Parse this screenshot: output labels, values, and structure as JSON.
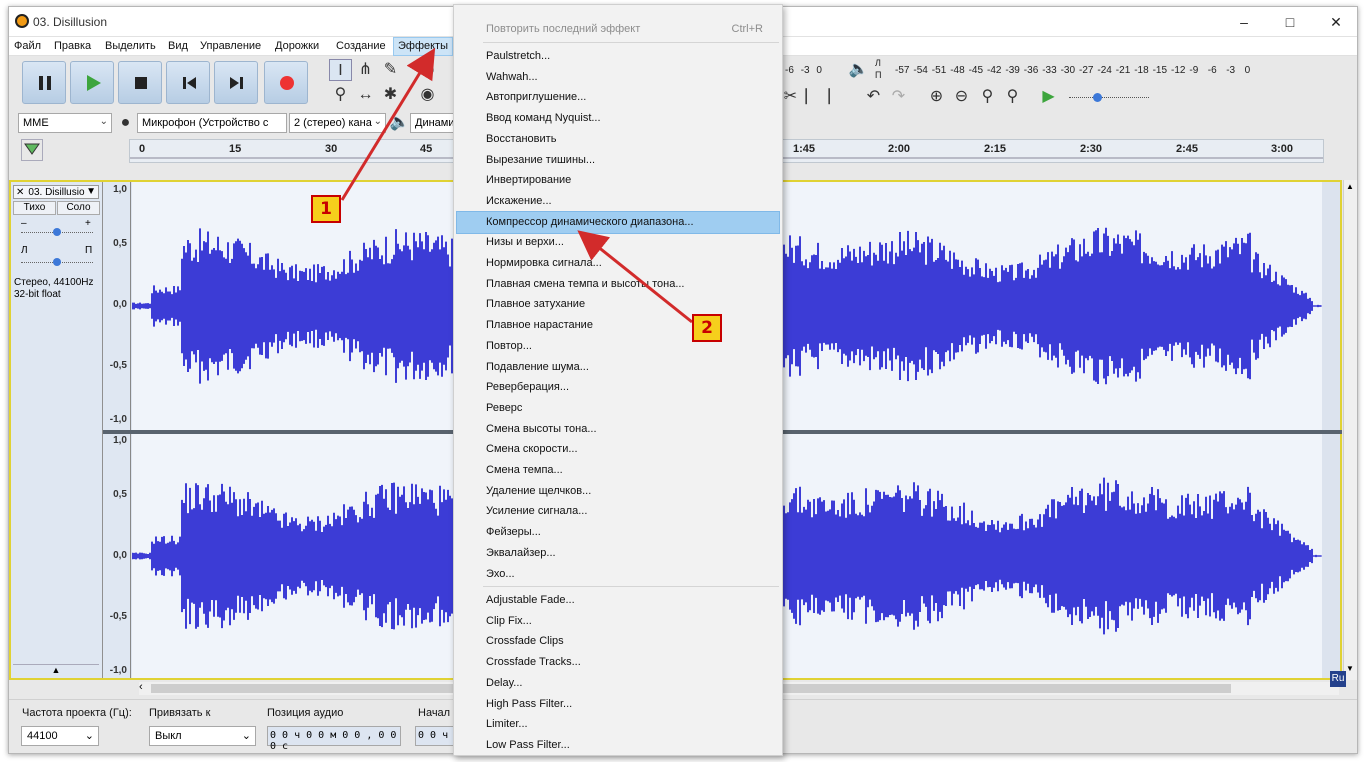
{
  "window": {
    "title": "03. Disillusion"
  },
  "menubar": {
    "items": [
      "Файл",
      "Правка",
      "Выделить",
      "Вид",
      "Управление",
      "Дорожки",
      "Создание",
      "Эффекты"
    ]
  },
  "toolbar": {
    "host": "MME",
    "microphone": "Микрофон (Устройство с",
    "channels": "2 (стерео) кана",
    "speaker": "Динами",
    "meter_left_ticks": [
      "-6",
      "-3",
      "0"
    ],
    "meter_right_ticks": [
      "-57",
      "-54",
      "-51",
      "-48",
      "-45",
      "-42",
      "-39",
      "-36",
      "-33",
      "-30",
      "-27",
      "-24",
      "-21",
      "-18",
      "-15",
      "-12",
      "-9",
      "-6",
      "-3",
      "0"
    ],
    "meter_labels": [
      "Л",
      "П"
    ]
  },
  "timeline": {
    "ticks": [
      "0",
      "15",
      "30",
      "45",
      "1:45",
      "2:00",
      "2:15",
      "2:30",
      "2:45",
      "3:00"
    ]
  },
  "track": {
    "name": "03. Disillusio",
    "mute": "Тихо",
    "solo": "Соло",
    "gain_minus": "–",
    "gain_plus": "+",
    "pan_left": "Л",
    "pan_right": "П",
    "info_line1": "Стерео, 44100Hz",
    "info_line2": "32-bit float",
    "ruler_labels": [
      "1,0",
      "0,5",
      "0,0",
      "-0,5",
      "-1,0"
    ]
  },
  "bottom": {
    "rate_label": "Частота проекта (Гц):",
    "rate_value": "44100",
    "snap_label": "Привязать к",
    "snap_value": "Выкл",
    "pos_label": "Позиция аудио",
    "pos_value": "0 0 ч 0 0 м 0 0 , 0 0 0 с",
    "start_label": "Начал",
    "start_value": "0 0 ч"
  },
  "effects_menu": {
    "repeat_label": "Повторить последний эффект",
    "repeat_shortcut": "Ctrl+R",
    "items": [
      "Paulstretch...",
      "Wahwah...",
      "Автоприглушение...",
      "Ввод команд Nyquist...",
      "Восстановить",
      "Вырезание тишины...",
      "Инвертирование",
      "Искажение...",
      "Компрессор динамического диапазона...",
      "Низы и верхи...",
      "Нормировка сигнала...",
      "Плавная смена темпа и высоты тона...",
      "Плавное затухание",
      "Плавное нарастание",
      "Повтор...",
      "Подавление шума...",
      "Реверберация...",
      "Реверс",
      "Смена высоты тона...",
      "Смена скорости...",
      "Смена темпа...",
      "Удаление щелчков...",
      "Усиление сигнала...",
      "Фейзеры...",
      "Эквалайзер...",
      "Эхо..."
    ],
    "highlighted_index": 8,
    "plugins": [
      "Adjustable Fade...",
      "Clip Fix...",
      "Crossfade Clips",
      "Crossfade Tracks...",
      "Delay...",
      "High Pass Filter...",
      "Limiter...",
      "Low Pass Filter..."
    ]
  },
  "annotations": {
    "badge1": "1",
    "badge2": "2"
  },
  "watermark": "Ru",
  "colors": {
    "waveform": "#3c3cd6",
    "highlight": "#9fcdf1",
    "arrow": "#d22b2b",
    "badge": "#f6cf1c"
  }
}
